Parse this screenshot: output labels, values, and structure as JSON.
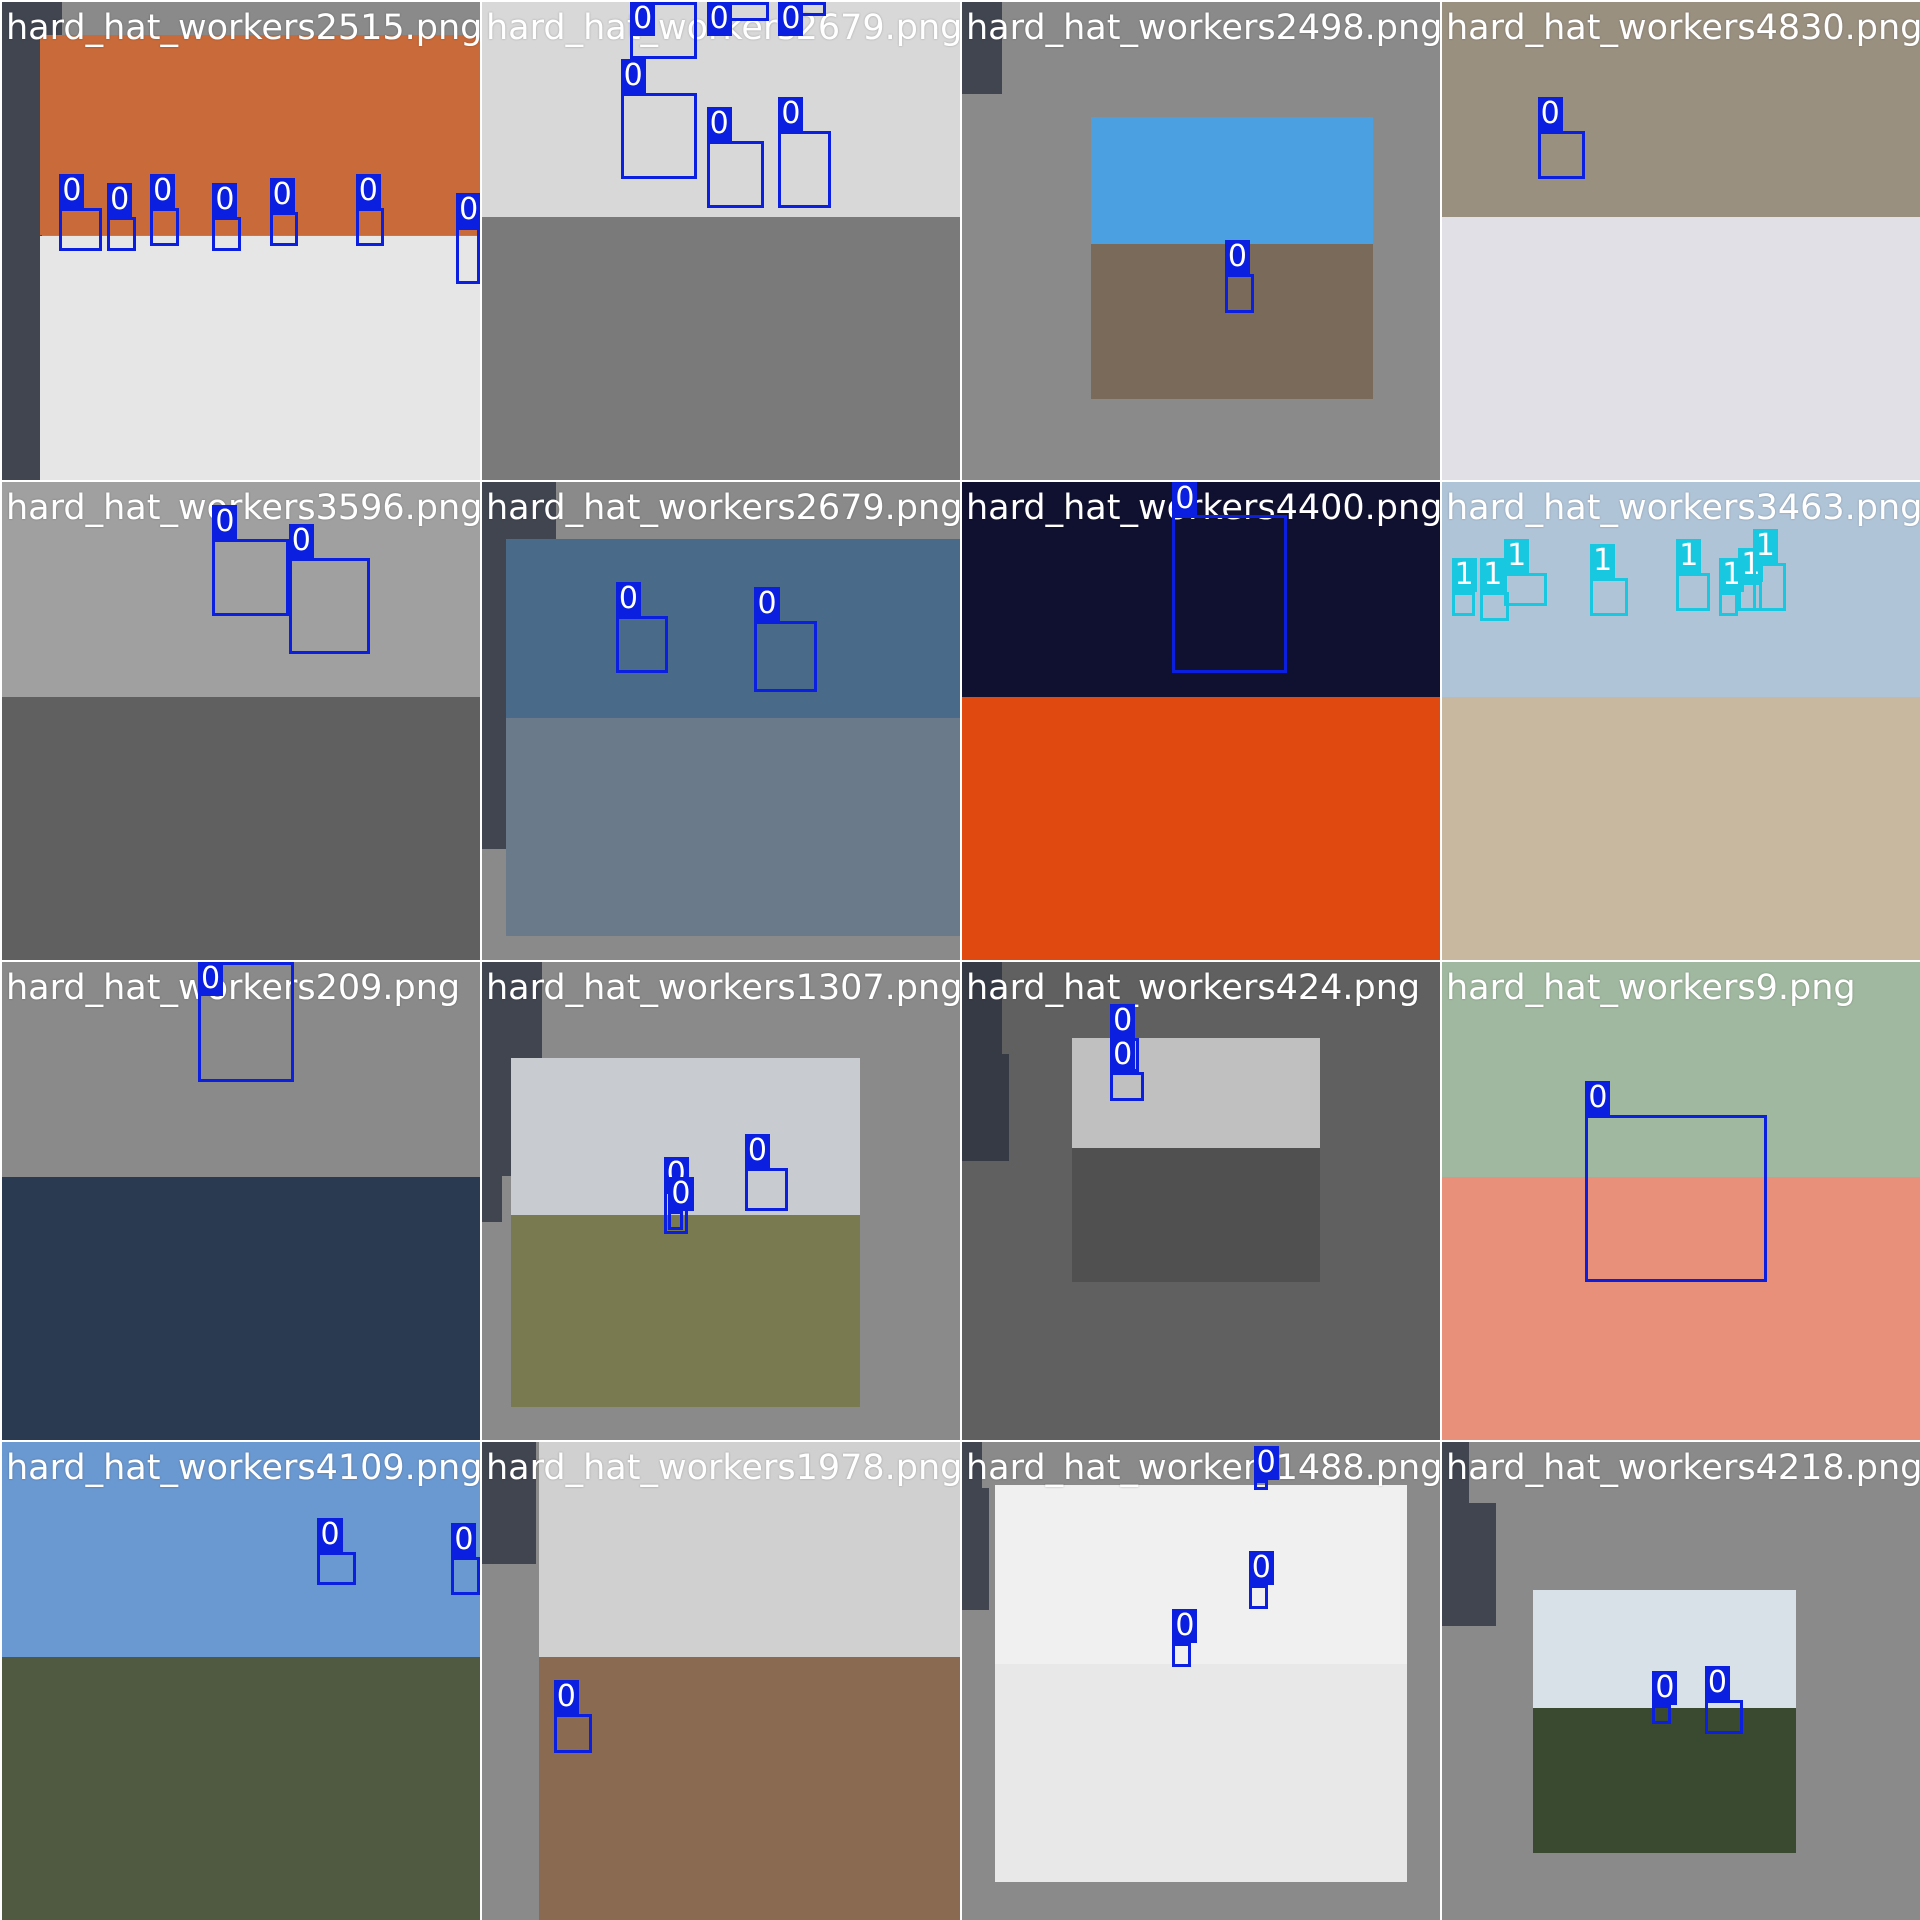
{
  "class_colors": {
    "0": "#0a1fe0",
    "1": "#18c8e0"
  },
  "tiles": [
    {
      "file": "hard_hat_workers2515.png",
      "bg": "#8a8a8a",
      "photo": [
        0.08,
        0.07,
        1.0,
        1.0
      ],
      "sky": "#c86a3a",
      "ground": "#e6e6e6",
      "boxes": [
        [
          0.12,
          0.43,
          0.21,
          0.52,
          "0"
        ],
        [
          0.22,
          0.45,
          0.28,
          0.52,
          "0"
        ],
        [
          0.31,
          0.43,
          0.37,
          0.51,
          "0"
        ],
        [
          0.44,
          0.45,
          0.5,
          0.52,
          "0"
        ],
        [
          0.56,
          0.44,
          0.62,
          0.51,
          "0"
        ],
        [
          0.74,
          0.43,
          0.8,
          0.51,
          "0"
        ],
        [
          0.95,
          0.47,
          1.0,
          0.59,
          "0"
        ]
      ]
    },
    {
      "file": "hard_hat_workers2679.png",
      "bg": "#9a9a9a",
      "photo": [
        0.0,
        0.0,
        1.0,
        1.0
      ],
      "sky": "#d8d8d8",
      "ground": "#7a7a7a",
      "boxes": [
        [
          0.31,
          0.0,
          0.45,
          0.12,
          "0"
        ],
        [
          0.47,
          0.0,
          0.6,
          0.04,
          "0"
        ],
        [
          0.62,
          0.0,
          0.72,
          0.03,
          "0"
        ],
        [
          0.29,
          0.19,
          0.45,
          0.37,
          "0"
        ],
        [
          0.47,
          0.29,
          0.59,
          0.43,
          "0"
        ],
        [
          0.62,
          0.27,
          0.73,
          0.43,
          "0"
        ]
      ]
    },
    {
      "file": "hard_hat_workers2498.png",
      "bg": "#8a8a8a",
      "photo": [
        0.27,
        0.24,
        0.86,
        0.83
      ],
      "sky": "#4aa0e0",
      "ground": "#7a6a5a",
      "boxes": [
        [
          0.55,
          0.57,
          0.61,
          0.65,
          "0"
        ]
      ]
    },
    {
      "file": "hard_hat_workers4830.png",
      "bg": "#8a8a8a",
      "photo": [
        0.0,
        0.0,
        1.0,
        1.0
      ],
      "sky": "#9a9080",
      "ground": "#e0e0e6",
      "boxes": [
        [
          0.2,
          0.27,
          0.3,
          0.37,
          "0"
        ]
      ]
    },
    {
      "file": "hard_hat_workers3596.png",
      "bg": "#9a9a9a",
      "photo": [
        0.0,
        0.0,
        1.0,
        1.0
      ],
      "sky": "#a0a0a0",
      "ground": "#606060",
      "boxes": [
        [
          0.44,
          0.12,
          0.6,
          0.28,
          "0"
        ],
        [
          0.6,
          0.16,
          0.77,
          0.36,
          "0"
        ]
      ]
    },
    {
      "file": "hard_hat_workers2679.png",
      "bg": "#8a8a8a",
      "photo": [
        0.05,
        0.12,
        1.0,
        0.95
      ],
      "sky": "#4a6a8a",
      "ground": "#6a7a8a",
      "boxes": [
        [
          0.28,
          0.28,
          0.39,
          0.4,
          "0"
        ],
        [
          0.57,
          0.29,
          0.7,
          0.44,
          "0"
        ]
      ]
    },
    {
      "file": "hard_hat_workers4400.png",
      "bg": "#101020",
      "photo": [
        0.0,
        0.0,
        1.0,
        1.0
      ],
      "sky": "#101030",
      "ground": "#e04a10",
      "boxes": [
        [
          0.44,
          0.07,
          0.68,
          0.4,
          "0"
        ]
      ]
    },
    {
      "file": "hard_hat_workers3463.png",
      "bg": "#8a8a8a",
      "photo": [
        0.0,
        0.0,
        1.0,
        1.0
      ],
      "sky": "#b0c4d8",
      "ground": "#c8b8a0",
      "boxes": [
        [
          0.02,
          0.23,
          0.07,
          0.28,
          "1"
        ],
        [
          0.08,
          0.23,
          0.14,
          0.29,
          "1"
        ],
        [
          0.13,
          0.19,
          0.22,
          0.26,
          "1"
        ],
        [
          0.31,
          0.2,
          0.39,
          0.28,
          "1"
        ],
        [
          0.49,
          0.19,
          0.56,
          0.27,
          "1"
        ],
        [
          0.58,
          0.23,
          0.62,
          0.28,
          "1"
        ],
        [
          0.62,
          0.21,
          0.67,
          0.27,
          "1"
        ],
        [
          0.65,
          0.17,
          0.72,
          0.27,
          "1"
        ]
      ]
    },
    {
      "file": "hard_hat_workers209.png",
      "bg": "#8a8a8a",
      "photo": [
        0.0,
        0.0,
        1.0,
        1.0
      ],
      "sky": "#8a8a8a",
      "ground": "#2a3a50",
      "boxes": [
        [
          0.41,
          0.0,
          0.61,
          0.25,
          "0"
        ]
      ]
    },
    {
      "file": "hard_hat_workers1307.png",
      "bg": "#8a8a8a",
      "photo": [
        0.06,
        0.2,
        0.79,
        0.93
      ],
      "sky": "#c8ccd0",
      "ground": "#7a7a50",
      "boxes": [
        [
          0.55,
          0.43,
          0.64,
          0.52,
          "0"
        ],
        [
          0.38,
          0.48,
          0.43,
          0.57,
          "0"
        ],
        [
          0.39,
          0.52,
          0.42,
          0.56,
          "0"
        ]
      ]
    },
    {
      "file": "hard_hat_workers424.png",
      "bg": "#606060",
      "photo": [
        0.23,
        0.16,
        0.75,
        0.67
      ],
      "sky": "#c0c0c0",
      "ground": "#505050",
      "boxes": [
        [
          0.31,
          0.16,
          0.37,
          0.23,
          "0"
        ],
        [
          0.31,
          0.23,
          0.38,
          0.29,
          "0"
        ]
      ]
    },
    {
      "file": "hard_hat_workers9.png",
      "bg": "#8a8a8a",
      "photo": [
        0.0,
        0.0,
        1.0,
        1.0
      ],
      "sky": "#a0b8a0",
      "ground": "#e8907a",
      "boxes": [
        [
          0.3,
          0.32,
          0.68,
          0.67,
          "0"
        ]
      ]
    },
    {
      "file": "hard_hat_workers4109.png",
      "bg": "#8a8a8a",
      "photo": [
        0.0,
        0.0,
        1.0,
        1.0
      ],
      "sky": "#6a98d0",
      "ground": "#505a40",
      "boxes": [
        [
          0.66,
          0.23,
          0.74,
          0.3,
          "0"
        ],
        [
          0.94,
          0.24,
          1.0,
          0.32,
          "0"
        ]
      ]
    },
    {
      "file": "hard_hat_workers1978.png",
      "bg": "#8a8a8a",
      "photo": [
        0.12,
        0.0,
        1.0,
        1.0
      ],
      "sky": "#d0d0d0",
      "ground": "#8a6a50",
      "boxes": [
        [
          0.15,
          0.57,
          0.23,
          0.65,
          "0"
        ]
      ]
    },
    {
      "file": "hard_hat_workers1488.png",
      "bg": "#8a8a8a",
      "photo": [
        0.07,
        0.09,
        0.93,
        0.92
      ],
      "sky": "#f0f0f0",
      "ground": "#e8e8e8",
      "boxes": [
        [
          0.61,
          0.08,
          0.64,
          0.1,
          "0"
        ],
        [
          0.6,
          0.3,
          0.64,
          0.35,
          "0"
        ],
        [
          0.44,
          0.42,
          0.48,
          0.47,
          "0"
        ]
      ]
    },
    {
      "file": "hard_hat_workers4218.png",
      "bg": "#8a8a8a",
      "photo": [
        0.19,
        0.31,
        0.74,
        0.86
      ],
      "sky": "#d8e0e8",
      "ground": "#3a4a30",
      "boxes": [
        [
          0.44,
          0.55,
          0.48,
          0.59,
          "0"
        ],
        [
          0.55,
          0.54,
          0.63,
          0.61,
          "0"
        ]
      ]
    }
  ]
}
